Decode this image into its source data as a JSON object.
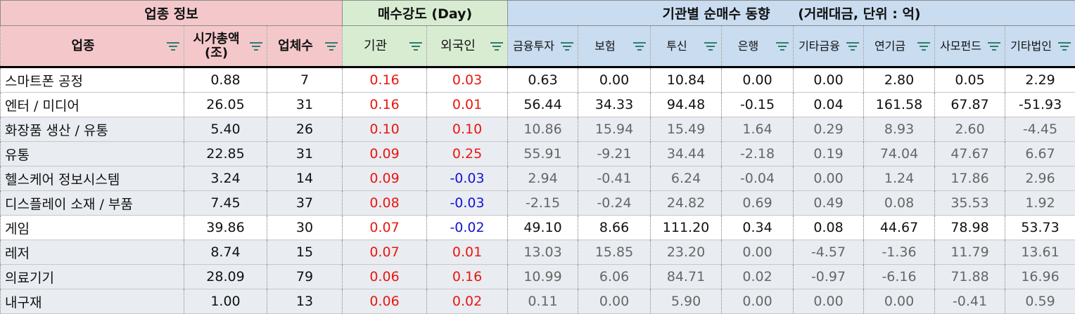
{
  "groups": {
    "info": "업종 정보",
    "buy": "매수강도 (Day)",
    "inst": "기관별 순매수 동향      (거래대금, 단위 : 억)"
  },
  "columns": {
    "sector": "업종",
    "mktcap": "시가총액\n(조)",
    "count": "업체수",
    "inst": "기관",
    "foreign": "외국인",
    "fin": "금융투자",
    "ins": "보험",
    "trust": "투신",
    "bank": "은행",
    "etcfin": "기타금융",
    "pension": "연기금",
    "pef": "사모펀드",
    "etccorp": "기타법인"
  },
  "colors": {
    "info_header": "#f4c8cb",
    "buy_header": "#d8ecd2",
    "inst_header": "#c9dcf0",
    "positive": "#e8170f",
    "negative": "#1414d0",
    "shaded_row": "#e9ecf1"
  },
  "rows": [
    {
      "sector": "스마트폰 공정",
      "mktcap": "0.88",
      "count": "7",
      "inst": "0.16",
      "foreign": "0.03",
      "fin": "0.63",
      "ins": "0.00",
      "trust": "10.84",
      "bank": "0.00",
      "etcfin": "0.00",
      "pension": "2.80",
      "pef": "0.05",
      "etccorp": "2.29"
    },
    {
      "sector": "엔터 / 미디어",
      "mktcap": "26.05",
      "count": "31",
      "inst": "0.16",
      "foreign": "0.01",
      "fin": "56.44",
      "ins": "34.33",
      "trust": "94.48",
      "bank": "-0.15",
      "etcfin": "0.04",
      "pension": "161.58",
      "pef": "67.87",
      "etccorp": "-51.93"
    },
    {
      "sector": "화장품 생산 / 유통",
      "mktcap": "5.40",
      "count": "26",
      "inst": "0.10",
      "foreign": "0.10",
      "fin": "10.86",
      "ins": "15.94",
      "trust": "15.49",
      "bank": "1.64",
      "etcfin": "0.29",
      "pension": "8.93",
      "pef": "2.60",
      "etccorp": "-4.45"
    },
    {
      "sector": "유통",
      "mktcap": "22.85",
      "count": "31",
      "inst": "0.09",
      "foreign": "0.25",
      "fin": "55.91",
      "ins": "-9.21",
      "trust": "34.44",
      "bank": "-2.18",
      "etcfin": "0.19",
      "pension": "74.04",
      "pef": "47.67",
      "etccorp": "6.67"
    },
    {
      "sector": "헬스케어 정보시스템",
      "mktcap": "3.24",
      "count": "14",
      "inst": "0.09",
      "foreign": "-0.03",
      "fin": "2.94",
      "ins": "-0.41",
      "trust": "6.24",
      "bank": "-0.04",
      "etcfin": "0.00",
      "pension": "1.24",
      "pef": "17.86",
      "etccorp": "2.96"
    },
    {
      "sector": "디스플레이 소재 / 부품",
      "mktcap": "7.45",
      "count": "37",
      "inst": "0.08",
      "foreign": "-0.03",
      "fin": "-2.15",
      "ins": "-0.24",
      "trust": "24.82",
      "bank": "0.69",
      "etcfin": "0.49",
      "pension": "0.08",
      "pef": "35.53",
      "etccorp": "1.92"
    },
    {
      "sector": "게임",
      "mktcap": "39.86",
      "count": "30",
      "inst": "0.07",
      "foreign": "-0.02",
      "fin": "49.10",
      "ins": "8.66",
      "trust": "111.20",
      "bank": "0.34",
      "etcfin": "0.08",
      "pension": "44.67",
      "pef": "78.98",
      "etccorp": "53.73"
    },
    {
      "sector": "레저",
      "mktcap": "8.74",
      "count": "15",
      "inst": "0.07",
      "foreign": "0.01",
      "fin": "13.03",
      "ins": "15.85",
      "trust": "23.20",
      "bank": "0.00",
      "etcfin": "-4.57",
      "pension": "-1.36",
      "pef": "11.79",
      "etccorp": "13.61"
    },
    {
      "sector": "의료기기",
      "mktcap": "28.09",
      "count": "79",
      "inst": "0.06",
      "foreign": "0.16",
      "fin": "10.99",
      "ins": "6.06",
      "trust": "84.71",
      "bank": "0.02",
      "etcfin": "-0.97",
      "pension": "-6.16",
      "pef": "71.88",
      "etccorp": "16.96"
    },
    {
      "sector": "내구재",
      "mktcap": "1.00",
      "count": "13",
      "inst": "0.06",
      "foreign": "0.02",
      "fin": "0.11",
      "ins": "0.00",
      "trust": "5.90",
      "bank": "0.00",
      "etcfin": "0.00",
      "pension": "0.00",
      "pef": "-0.41",
      "etccorp": "0.59"
    }
  ]
}
